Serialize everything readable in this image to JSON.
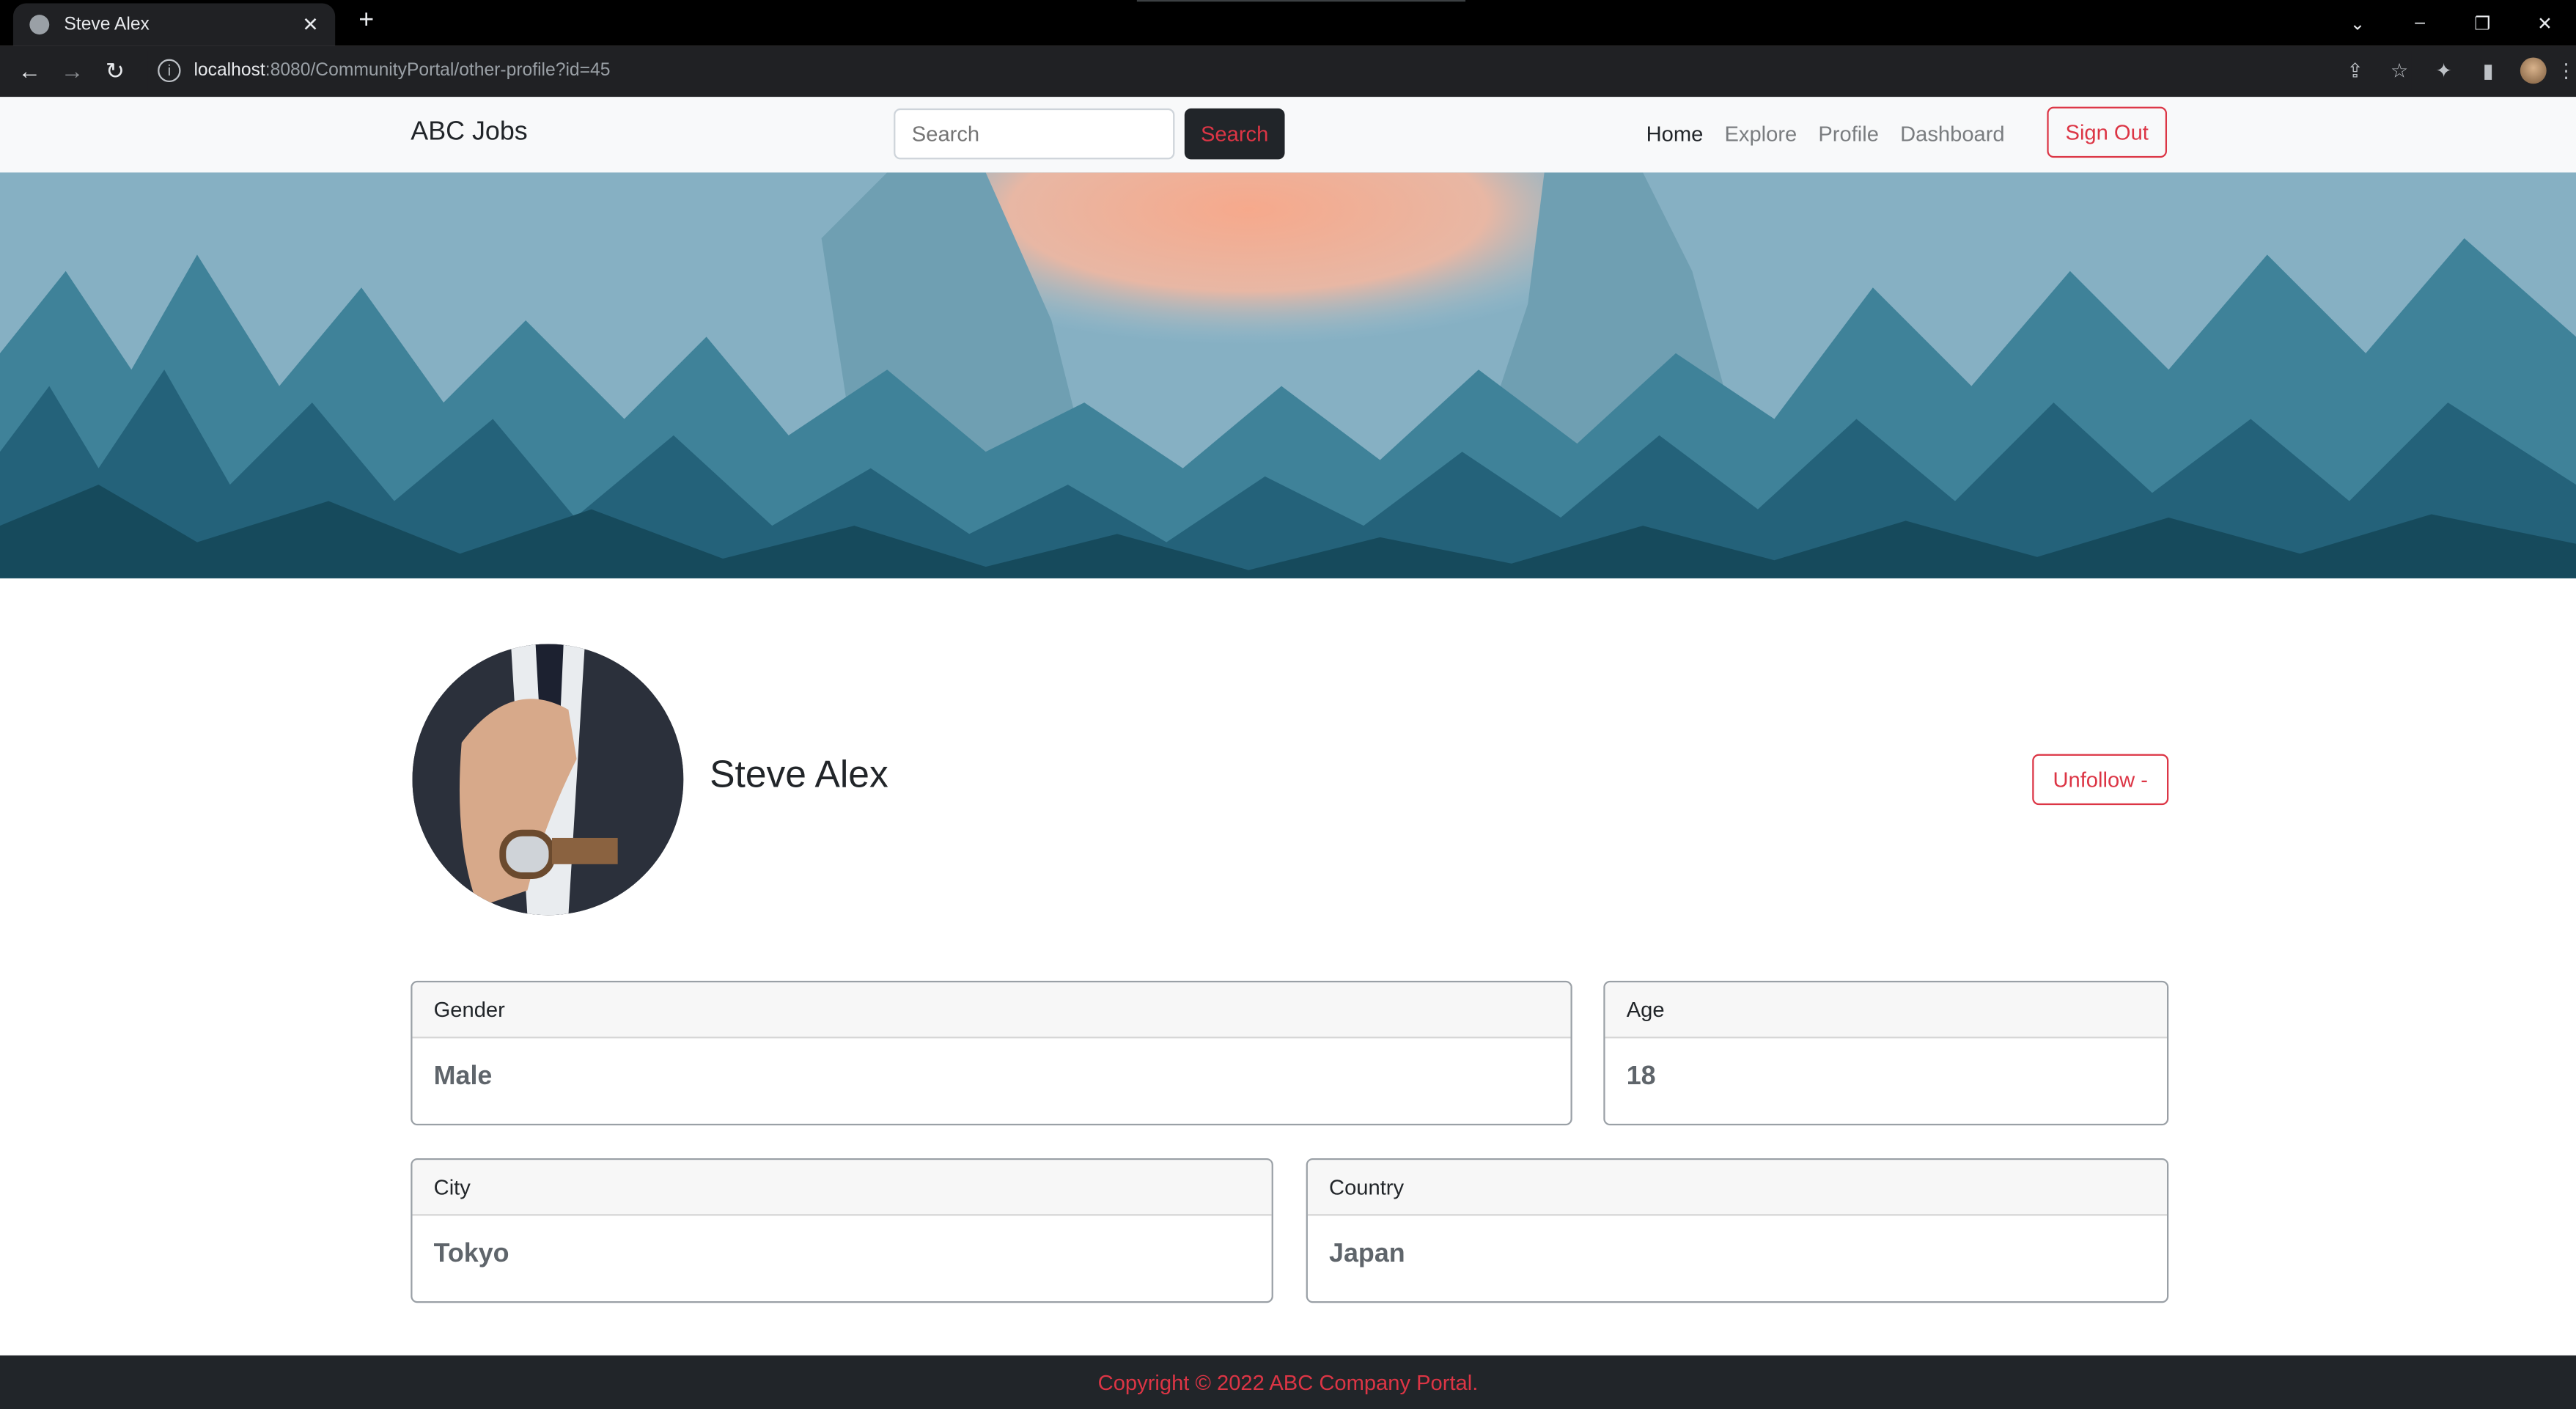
{
  "browser": {
    "tab_title": "Steve Alex",
    "url_host": "localhost",
    "url_rest": ":8080/CommunityPortal/other-profile?id=45"
  },
  "site": {
    "brand": "ABC Jobs",
    "search_placeholder": "Search",
    "search_button": "Search",
    "nav": [
      "Home",
      "Explore",
      "Profile",
      "Dashboard"
    ],
    "sign_out": "Sign Out"
  },
  "profile": {
    "name": "Steve Alex",
    "unfollow_button": "Unfollow -",
    "fields": {
      "gender": {
        "label": "Gender",
        "value": "Male"
      },
      "age": {
        "label": "Age",
        "value": "18"
      },
      "city": {
        "label": "City",
        "value": "Tokyo"
      },
      "country": {
        "label": "Country",
        "value": "Japan"
      }
    }
  },
  "footer": {
    "copyright": "Copyright © 2022 ABC Company Portal."
  }
}
